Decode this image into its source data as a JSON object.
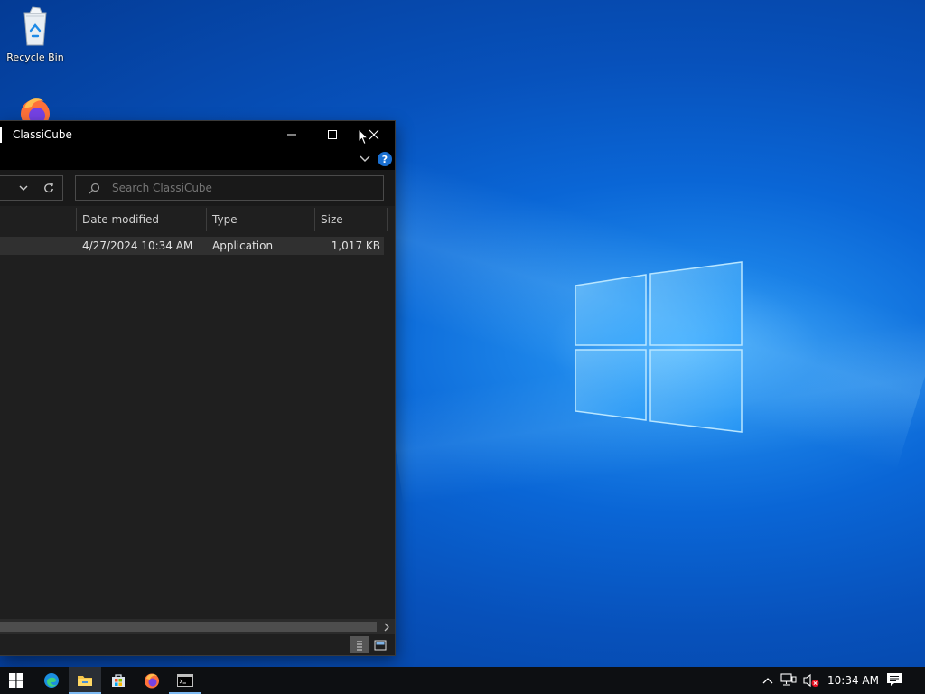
{
  "desktop": {
    "icons": [
      {
        "label": "Recycle Bin",
        "icon": "recycle-bin-icon"
      },
      {
        "label": "",
        "icon": "firefox-icon"
      }
    ]
  },
  "explorer": {
    "title": "ClassiCube",
    "search_placeholder": "Search ClassiCube",
    "columns": [
      "Date modified",
      "Type",
      "Size"
    ],
    "rows": [
      {
        "date": "4/27/2024 10:34 AM",
        "type": "Application",
        "size": "1,017 KB"
      }
    ]
  },
  "taskbar": {
    "apps": [
      "start-icon",
      "edge-icon",
      "file-explorer-icon",
      "store-icon",
      "firefox-icon",
      "cmd-icon"
    ],
    "clock": "10:34 AM"
  },
  "colors": {
    "accent": "#0a66d6",
    "window_bg": "#1f1f1f",
    "taskbar_bg": "#0d0f12"
  }
}
